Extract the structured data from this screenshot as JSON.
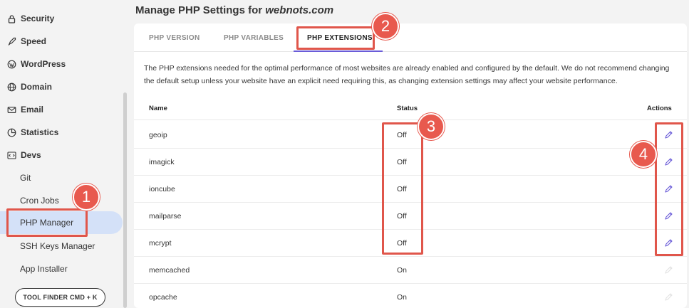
{
  "sidebar": {
    "items": [
      {
        "label": "Security",
        "icon": "lock-icon"
      },
      {
        "label": "Speed",
        "icon": "rocket-icon"
      },
      {
        "label": "WordPress",
        "icon": "wordpress-icon"
      },
      {
        "label": "Domain",
        "icon": "globe-icon"
      },
      {
        "label": "Email",
        "icon": "envelope-icon"
      },
      {
        "label": "Statistics",
        "icon": "pie-chart-icon"
      },
      {
        "label": "Devs",
        "icon": "code-icon"
      }
    ],
    "subitems": [
      {
        "label": "Git"
      },
      {
        "label": "Cron Jobs"
      },
      {
        "label": "PHP Manager"
      },
      {
        "label": "SSH Keys Manager"
      },
      {
        "label": "App Installer"
      }
    ],
    "active_subitem": "PHP Manager",
    "tool_finder": "TOOL FINDER CMD + K"
  },
  "header": {
    "title_prefix": "Manage PHP Settings for ",
    "title_domain": "webnots.com"
  },
  "tabs": [
    {
      "label": "PHP VERSION"
    },
    {
      "label": "PHP VARIABLES"
    },
    {
      "label": "PHP EXTENSIONS"
    }
  ],
  "active_tab": "PHP EXTENSIONS",
  "description": "The PHP extensions needed for the optimal performance of most websites are already enabled and configured by the default. We do not recommend changing the default setup unless your website have an explicit need requiring this, as changing extension settings may affect your website performance.",
  "table": {
    "columns": {
      "name": "Name",
      "status": "Status",
      "actions": "Actions"
    },
    "rows": [
      {
        "name": "geoip",
        "status": "Off",
        "editable": true
      },
      {
        "name": "imagick",
        "status": "Off",
        "editable": true
      },
      {
        "name": "ioncube",
        "status": "Off",
        "editable": true
      },
      {
        "name": "mailparse",
        "status": "Off",
        "editable": true
      },
      {
        "name": "mcrypt",
        "status": "Off",
        "editable": true
      },
      {
        "name": "memcached",
        "status": "On",
        "editable": false
      },
      {
        "name": "opcache",
        "status": "On",
        "editable": false
      }
    ]
  },
  "annotations": [
    "1",
    "2",
    "3",
    "4"
  ],
  "colors": {
    "accent": "#6a5cd8",
    "active_bg": "#d4e1f8",
    "annotation": "#e0564b",
    "background": "#f3f3f3"
  }
}
